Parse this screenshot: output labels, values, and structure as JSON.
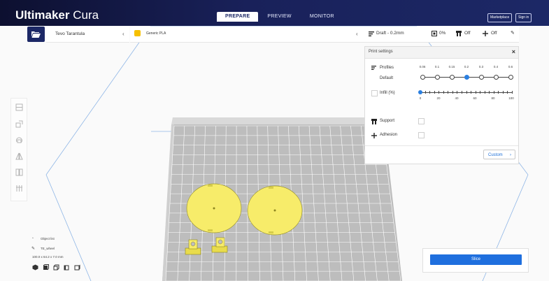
{
  "app": {
    "brand_bold": "Ultimaker",
    "brand_light": "Cura",
    "stages": [
      "PREPARE",
      "PREVIEW",
      "MONITOR"
    ],
    "active_stage": "PREPARE",
    "marketplace_label": "Marketplace",
    "signin_label": "Sign in"
  },
  "machine": {
    "name": "Tevo Tarantula"
  },
  "material": {
    "name": "Generic PLA",
    "color": "#f6c000"
  },
  "print_bar": {
    "profile_label": "Draft - 0.2mm",
    "infill_label": "0%",
    "support_label": "Off",
    "adhesion_label": "Off"
  },
  "print_settings": {
    "title": "Print settings",
    "profiles_label": "Profiles",
    "profile_value": "Default",
    "layer_heights": [
      "0.06",
      "0.1",
      "0.15",
      "0.2",
      "0.3",
      "0.4",
      "0.6"
    ],
    "selected_layer_height": "0.2",
    "infill_label": "Infill (%)",
    "infill_ticks": [
      "0",
      "20",
      "40",
      "60",
      "80",
      "100"
    ],
    "infill_value": 0,
    "support_label": "Support",
    "adhesion_label": "Adhesion",
    "custom_label": "Custom"
  },
  "object_list": {
    "header": "Object list",
    "object_name": "TE_wheel",
    "dimensions": "100.0 x 64.2 x 7.0 mm"
  },
  "slice": {
    "label": "Slice"
  },
  "colors": {
    "header_dark": "#0d1030",
    "header_blue": "#1c2866",
    "accent_blue": "#1f6fde",
    "model_yellow": "#f7ec6a"
  },
  "icons": {
    "open": "folder-open-icon",
    "profile": "settings-lines-icon",
    "infill": "infill-square-icon",
    "support": "support-icon",
    "adhesion": "adhesion-icon",
    "edit": "pencil-icon",
    "close": "close-icon"
  }
}
